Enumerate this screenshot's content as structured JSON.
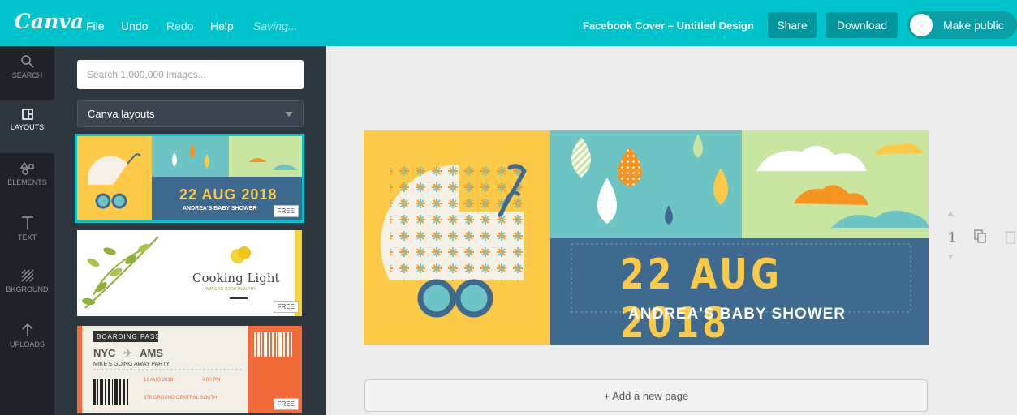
{
  "topbar": {
    "logo": "Canva",
    "menu": {
      "file": "File",
      "undo": "Undo",
      "redo": "Redo",
      "help": "Help"
    },
    "status": "Saving...",
    "doc_title": "Facebook Cover – Untitled Design",
    "share": "Share",
    "download": "Download",
    "make_public": "Make public"
  },
  "rail": {
    "search": "SEARCH",
    "layouts": "LAYOUTS",
    "elements": "ELEMENTS",
    "text": "TEXT",
    "background": "BKGROUND",
    "uploads": "UPLOADS"
  },
  "panel": {
    "search_placeholder": "Search 1,000,000 images...",
    "dropdown_selected": "Canva layouts",
    "free_badge": "FREE",
    "layout1": {
      "date": "22 AUG 2018",
      "event": "ANDREA'S BABY SHOWER"
    },
    "layout2": {
      "title": "Cooking Light",
      "tagline": "WAYS TO COOK HEALTHY"
    },
    "layout3": {
      "label": "BOARDING PASS",
      "route_from": "NYC",
      "route_to": "AMS",
      "party": "MIKE'S GOING AWAY PARTY",
      "date": "12 AUG 2018",
      "time": "4:00 PM",
      "venue": "378 GROUND CENTRAL SOUTH"
    }
  },
  "canvas": {
    "date": "22 AUG 2018",
    "event": "ANDREA'S BABY SHOWER",
    "page_number": "1",
    "add_page": "+ Add a new page"
  },
  "colors": {
    "brand": "#00c4cc",
    "panel": "#2e3640",
    "rail": "#1f2329",
    "design_yellow": "#fcca46",
    "design_teal": "#6cc4c4",
    "design_green": "#c8e6a0",
    "design_blue": "#3d6a8e",
    "design_orange": "#f7931e"
  }
}
